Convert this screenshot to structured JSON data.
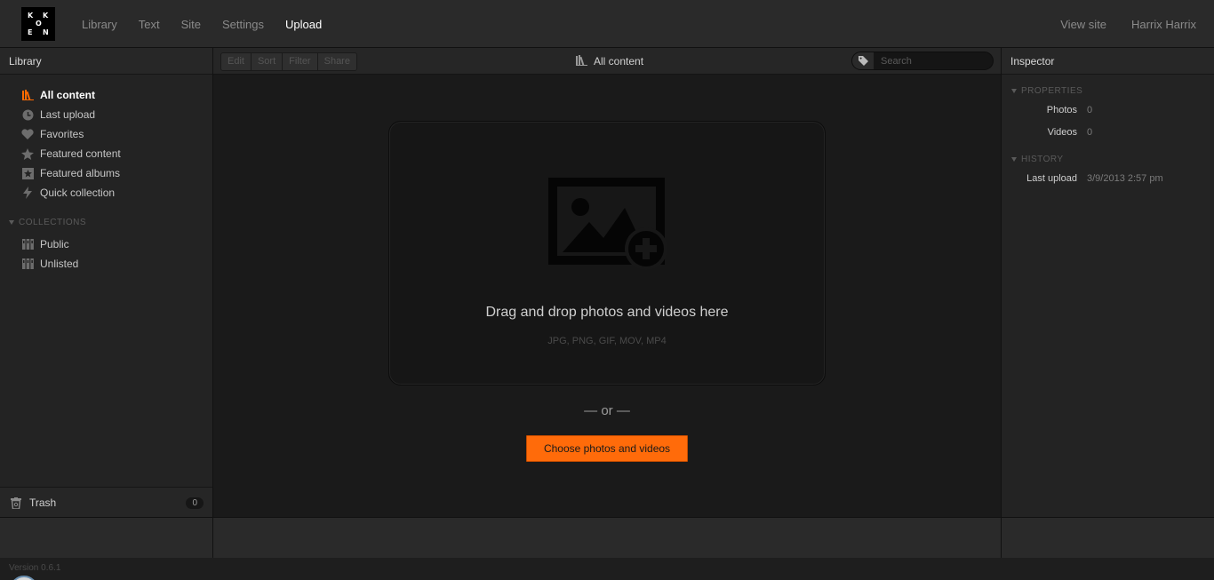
{
  "app": {
    "logo_letters": [
      "K",
      "K",
      "O",
      "E",
      "N"
    ],
    "nav": [
      "Library",
      "Text",
      "Site",
      "Settings",
      "Upload"
    ],
    "nav_active": "Upload",
    "top_right": {
      "view_site": "View site",
      "user": "Harrix Harrix"
    }
  },
  "sidebar": {
    "header": "Library",
    "items": [
      {
        "label": "All content",
        "icon": "library-icon",
        "active": true
      },
      {
        "label": "Last upload",
        "icon": "clock-icon"
      },
      {
        "label": "Favorites",
        "icon": "heart-icon"
      },
      {
        "label": "Featured content",
        "icon": "star-icon"
      },
      {
        "label": "Featured albums",
        "icon": "starred-album-icon"
      },
      {
        "label": "Quick collection",
        "icon": "lightning-icon"
      }
    ],
    "collections_label": "COLLECTIONS",
    "collections": [
      {
        "label": "Public",
        "icon": "album-icon"
      },
      {
        "label": "Unlisted",
        "icon": "album-icon"
      }
    ],
    "trash": {
      "label": "Trash",
      "count": "0"
    }
  },
  "toolbar": {
    "buttons": [
      "Edit",
      "Sort",
      "Filter",
      "Share"
    ],
    "crumb": "All content",
    "search_placeholder": "Search"
  },
  "upload": {
    "title": "Drag and drop photos and videos here",
    "formats": "JPG, PNG, GIF, MOV, MP4",
    "or": "— or —",
    "choose_label": "Choose photos and videos"
  },
  "inspector": {
    "header": "Inspector",
    "properties_label": "PROPERTIES",
    "properties": [
      {
        "key": "Photos",
        "value": "0"
      },
      {
        "key": "Videos",
        "value": "0"
      }
    ],
    "history_label": "HISTORY",
    "history": [
      {
        "key": "Last upload",
        "value": "3/9/2013 2:57 pm"
      }
    ]
  },
  "footer": {
    "version": "Version 0.6.1"
  },
  "colors": {
    "accent": "#ff6b0a",
    "background": "#1a1a1a",
    "panel": "#232323"
  }
}
